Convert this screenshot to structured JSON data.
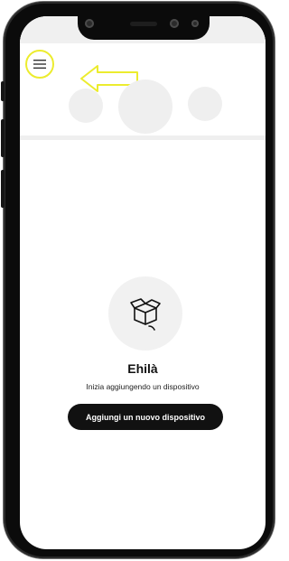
{
  "empty_state": {
    "title": "Ehilà",
    "subtitle": "Inizia aggiungendo un dispositivo",
    "add_button_label": "Aggiungi un nuovo dispositivo",
    "icon": "open-box-icon"
  },
  "header": {
    "menu_icon": "hamburger-menu-icon"
  },
  "annotation": {
    "highlight_color": "#ecec2e",
    "arrow_icon": "arrow-left-icon"
  }
}
